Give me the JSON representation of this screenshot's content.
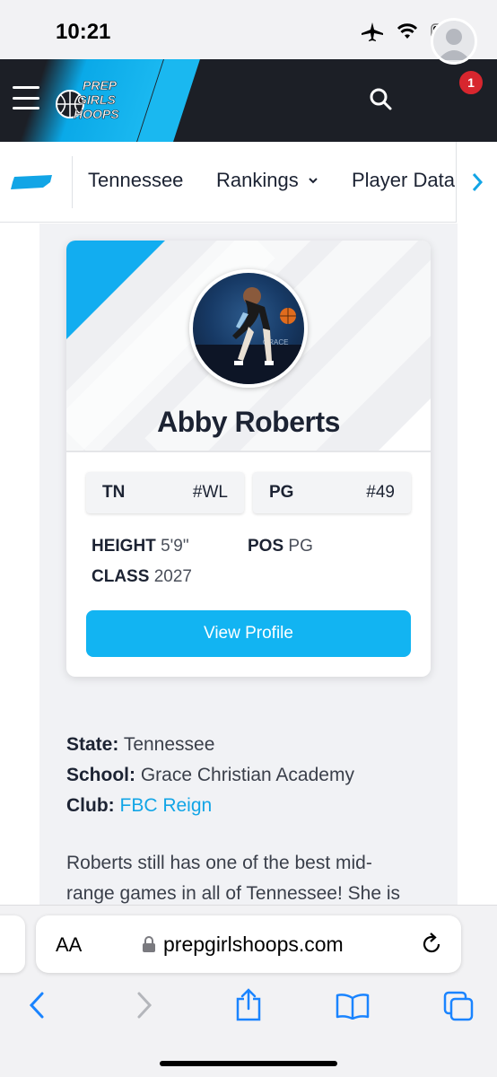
{
  "status_bar": {
    "time": "10:21"
  },
  "header": {
    "logo_lines": [
      "PREP",
      "GIRLS",
      "HOOPS"
    ],
    "notification_count": "1",
    "accent_color": "#12b4f2"
  },
  "sub_nav": {
    "items": [
      "Tennessee",
      "Rankings",
      "Player Data"
    ]
  },
  "player_card": {
    "name": "Abby Roberts",
    "rankings": [
      {
        "key": "TN",
        "value": "#WL"
      },
      {
        "key": "PG",
        "value": "#49"
      }
    ],
    "height_label": "HEIGHT",
    "height_value": "5'9\"",
    "pos_label": "POS",
    "pos_value": "PG",
    "class_label": "CLASS",
    "class_value": "2027",
    "button_label": "View Profile"
  },
  "details": {
    "state_label": "State:",
    "state_value": "Tennessee",
    "school_label": "School:",
    "school_value": "Grace Christian Academy",
    "club_label": "Club:",
    "club_value": "FBC Reign"
  },
  "paragraph": {
    "line1": "Roberts still has one of the best mid-",
    "line2": "range games in all of Tennessee! She is"
  },
  "browser": {
    "aa_label": "AA",
    "url": "prepgirlshoops.com"
  }
}
